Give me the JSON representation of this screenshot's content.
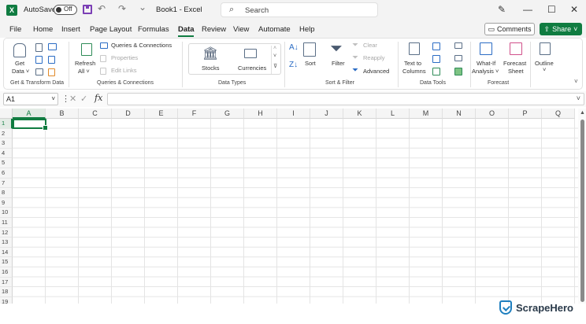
{
  "titlebar": {
    "autosave_label": "AutoSave",
    "autosave_state": "Off",
    "book_title": "Book1 - Excel",
    "search_placeholder": "Search",
    "undo_glyph": "↶",
    "redo_glyph": "↷",
    "customize_glyph": "⌄",
    "pen_glyph": "✎",
    "minimize_glyph": "—",
    "maximize_glyph": "☐",
    "close_glyph": "✕"
  },
  "menu": {
    "tabs": [
      "File",
      "Home",
      "Insert",
      "Page Layout",
      "Formulas",
      "Data",
      "Review",
      "View",
      "Automate",
      "Help"
    ],
    "active_tab": "Data",
    "comments_label": "Comments",
    "share_label": "Share",
    "accent_color": "#107c41"
  },
  "ribbon": {
    "get_transform": {
      "get_data": [
        "Get",
        "Data ˅"
      ],
      "group_label": "Get & Transform Data"
    },
    "queries": {
      "refresh": [
        "Refresh",
        "All ˅"
      ],
      "queries_connections": "Queries & Connections",
      "properties": "Properties",
      "edit_links": "Edit Links",
      "group_label": "Queries & Connections"
    },
    "data_types": {
      "stocks": "Stocks",
      "currencies": "Currencies",
      "group_label": "Data Types"
    },
    "sort_filter": {
      "sort": "Sort",
      "filter": "Filter",
      "clear": "Clear",
      "reapply": "Reapply",
      "advanced": "Advanced",
      "group_label": "Sort & Filter"
    },
    "data_tools": {
      "text_to_columns": [
        "Text to",
        "Columns"
      ],
      "group_label": "Data Tools"
    },
    "forecast": {
      "what_if": [
        "What-If",
        "Analysis ˅"
      ],
      "forecast_sheet": [
        "Forecast",
        "Sheet"
      ],
      "group_label": "Forecast"
    },
    "outline": {
      "label": "Outline"
    }
  },
  "formula_bar": {
    "name_box": "A1",
    "fx_label": "fx",
    "formula_value": ""
  },
  "sheet": {
    "columns": [
      "A",
      "B",
      "C",
      "D",
      "E",
      "F",
      "G",
      "H",
      "I",
      "J",
      "K",
      "L",
      "M",
      "N",
      "O",
      "P",
      "Q"
    ],
    "rows": [
      "1",
      "2",
      "3",
      "4",
      "5",
      "6",
      "7",
      "8",
      "9",
      "10",
      "11",
      "12",
      "13",
      "14",
      "15",
      "16",
      "17",
      "18",
      "19"
    ],
    "selected_cell": "A1"
  },
  "watermark": {
    "brand": "ScrapeHero"
  }
}
